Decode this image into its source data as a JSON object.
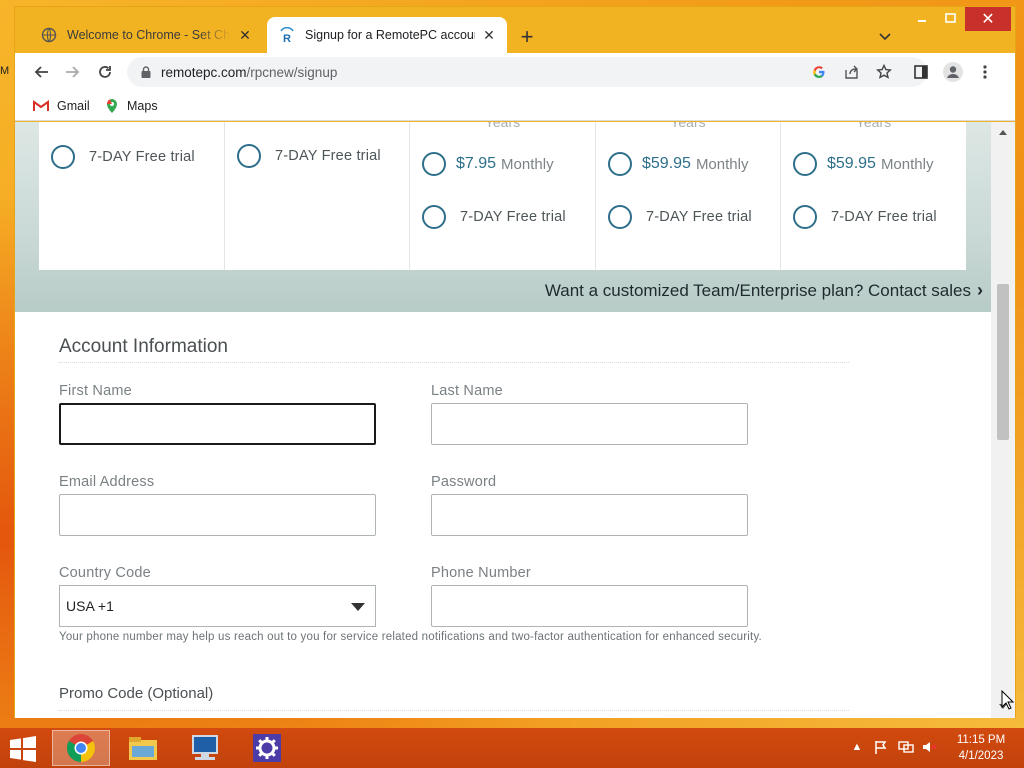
{
  "desktop": {
    "sliver_text": "M"
  },
  "browser": {
    "tabs": [
      {
        "title": "Welcome to Chrome - Set Chrome",
        "favicon": "globe-icon",
        "active": false
      },
      {
        "title": "Signup for a RemotePC account",
        "favicon": "remotepc-icon",
        "active": true
      }
    ],
    "new_tab_label": "+",
    "window_controls": {
      "minimize": "minimize-icon",
      "maximize": "maximize-icon",
      "close": "close-icon"
    },
    "address_host": "remotepc.com",
    "address_path": "/rpcnew/signup",
    "bookmarks": [
      {
        "label": "Gmail",
        "icon": "gmail-icon"
      },
      {
        "label": "Maps",
        "icon": "maps-icon"
      }
    ]
  },
  "plans": {
    "peek_label": "Years",
    "columns": [
      {
        "peek": "",
        "options": [
          {
            "trial": "7-DAY Free trial"
          }
        ]
      },
      {
        "peek": "",
        "options": [
          {
            "trial": "7-DAY Free trial"
          }
        ]
      },
      {
        "peek": "Years",
        "price": "$7.95",
        "per": "Monthly",
        "trial": "7-DAY Free trial"
      },
      {
        "peek": "Years",
        "price": "$59.95",
        "per": "Monthly",
        "trial": "7-DAY Free trial"
      },
      {
        "peek": "Years",
        "price": "$59.95",
        "per": "Monthly",
        "trial": "7-DAY Free trial"
      }
    ],
    "contact_sales": "Want a customized Team/Enterprise plan? Contact sales"
  },
  "account": {
    "title": "Account Information",
    "first_name_label": "First Name",
    "last_name_label": "Last Name",
    "email_label": "Email Address",
    "password_label": "Password",
    "country_code_label": "Country Code",
    "country_code_value": "USA +1",
    "phone_label": "Phone Number",
    "helper": "Your phone number may help us reach out to you for service related notifications and two-factor authentication for enhanced security.",
    "promo_label": "Promo Code (Optional)"
  },
  "taskbar": {
    "apps": [
      "chrome-icon",
      "file-explorer-icon",
      "remote-desktop-icon",
      "settings-gear-icon"
    ],
    "time": "11:15 PM",
    "date": "4/1/2023"
  },
  "colors": {
    "accent": "#2d6f8a",
    "desktop": "#f3a21c",
    "taskbar": "#c1420c",
    "close_button": "#c7302b"
  }
}
